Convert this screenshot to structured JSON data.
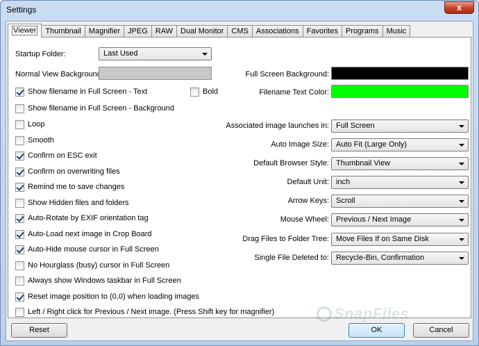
{
  "window": {
    "title": "Settings",
    "close_glyph": "x"
  },
  "tabs": [
    "Viewer",
    "Thumbnail",
    "Magnifier",
    "JPEG",
    "RAW",
    "Dual Monitor",
    "CMS",
    "Associations",
    "Favorites",
    "Programs",
    "Music"
  ],
  "left": {
    "startup_folder_label": "Startup Folder:",
    "startup_folder_value": "Last Used",
    "normal_bg_label": "Normal View Background:",
    "normal_bg_color": "#c8c8c8",
    "bold_label": "Bold",
    "checkboxes": [
      {
        "label": "Show filename in Full Screen - Text",
        "checked": true
      },
      {
        "label": "Show filename in Full Screen - Background",
        "checked": false
      },
      {
        "label": "Loop",
        "checked": false
      },
      {
        "label": "Smooth",
        "checked": false
      },
      {
        "label": "Confirm on ESC exit",
        "checked": true
      },
      {
        "label": "Confirm on overwriting files",
        "checked": true
      },
      {
        "label": "Remind me to save changes",
        "checked": true
      },
      {
        "label": "Show Hidden files and folders",
        "checked": false
      },
      {
        "label": "Auto-Rotate by EXIF orientation tag",
        "checked": true
      },
      {
        "label": "Auto-Load next image in Crop Board",
        "checked": true
      },
      {
        "label": "Auto-Hide mouse cursor in Full Screen",
        "checked": true
      },
      {
        "label": "No Hourglass (busy) cursor in Full Screen",
        "checked": false
      },
      {
        "label": "Always show Windows taskbar in Full Screen",
        "checked": false
      },
      {
        "label": "Reset image position to (0,0) when loading images",
        "checked": true
      },
      {
        "label": "Left / Right click for Previous / Next image. (Press Shift key for magnifier)",
        "checked": false
      }
    ]
  },
  "right": {
    "full_screen_bg_label": "Full Screen Background:",
    "full_screen_bg_color": "#000000",
    "filename_text_color_label": "Filename Text Color:",
    "filename_text_color": "#00ff00",
    "combos": [
      {
        "label": "Associated image launches in:",
        "value": "Full Screen"
      },
      {
        "label": "Auto Image Size:",
        "value": "Auto Fit (Large Only)"
      },
      {
        "label": "Default Browser Style:",
        "value": "Thumbnail View"
      },
      {
        "label": "Default Unit:",
        "value": "inch"
      },
      {
        "label": "Arrow Keys:",
        "value": "Scroll"
      },
      {
        "label": "Mouse Wheel:",
        "value": "Previous / Next Image"
      },
      {
        "label": "Drag Files to Folder Tree:",
        "value": "Move Files If on Same Disk"
      },
      {
        "label": "Single File Deleted to:",
        "value": "Recycle-Bin, Confirmation"
      }
    ]
  },
  "buttons": {
    "reset": "Reset",
    "ok": "OK",
    "cancel": "Cancel"
  },
  "watermark": "SnapFiles"
}
